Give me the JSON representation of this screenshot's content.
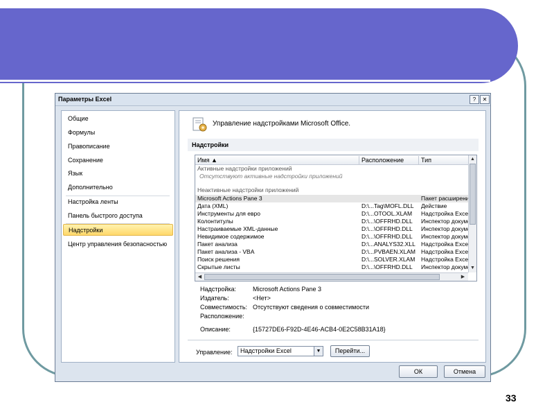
{
  "slide": {
    "number": "33"
  },
  "dialog": {
    "title": "Параметры Excel",
    "help_label": "?",
    "close_label": "✕",
    "nav": {
      "items": [
        {
          "label": "Общие"
        },
        {
          "label": "Формулы"
        },
        {
          "label": "Правописание"
        },
        {
          "label": "Сохранение"
        },
        {
          "label": "Язык"
        },
        {
          "label": "Дополнительно"
        },
        {
          "label": "Настройка ленты"
        },
        {
          "label": "Панель быстрого доступа"
        },
        {
          "label": "Надстройки",
          "selected": true
        },
        {
          "label": "Центр управления безопасностью"
        }
      ]
    },
    "header_text": "Управление надстройками Microsoft Office.",
    "section_title": "Надстройки",
    "grid": {
      "columns": [
        "Имя ▲",
        "Расположение",
        "Тип"
      ],
      "active_group": "Активные надстройки приложений",
      "active_note": "Отсутствуют активные надстройки приложений",
      "inactive_group": "Неактивные надстройки приложений",
      "rows": [
        {
          "name": "Microsoft Actions Pane 3",
          "location": "",
          "type": "Пакет расширения XML",
          "highlighted": true
        },
        {
          "name": "Дата (XML)",
          "location": "D:\\...Tag\\MOFL.DLL",
          "type": "Действие"
        },
        {
          "name": "Инструменты для евро",
          "location": "D:\\...OTOOL.XLAM",
          "type": "Надстройка Excel"
        },
        {
          "name": "Колонтитулы",
          "location": "D:\\...\\OFFRHD.DLL",
          "type": "Инспектор документов"
        },
        {
          "name": "Настраиваемые XML-данные",
          "location": "D:\\...\\OFFRHD.DLL",
          "type": "Инспектор документов"
        },
        {
          "name": "Невидимое содержимое",
          "location": "D:\\...\\OFFRHD.DLL",
          "type": "Инспектор документов"
        },
        {
          "name": "Пакет анализа",
          "location": "D:\\...ANALYS32.XLL",
          "type": "Надстройка Excel"
        },
        {
          "name": "Пакет анализа - VBA",
          "location": "D:\\...PVBAEN.XLAM",
          "type": "Надстройка Excel"
        },
        {
          "name": "Поиск решения",
          "location": "D:\\...SOLVER.XLAM",
          "type": "Надстройка Excel"
        },
        {
          "name": "Скрытые листы",
          "location": "D:\\...\\OFFRHD.DLL",
          "type": "Инспектор документов"
        }
      ]
    },
    "details": [
      {
        "label": "Надстройка:",
        "value": "Microsoft Actions Pane 3"
      },
      {
        "label": "Издатель:",
        "value": "<Нет>"
      },
      {
        "label": "Совместимость:",
        "value": "Отсутствуют сведения о совместимости"
      },
      {
        "label": "Расположение:",
        "value": ""
      },
      {
        "label": "Описание:",
        "value": "{15727DE6-F92D-4E46-ACB4-0E2C58B31A18}"
      }
    ],
    "manage": {
      "label": "Управление:",
      "selected": "Надстройки Excel",
      "go_label": "Перейти..."
    },
    "ok_label": "ОК",
    "cancel_label": "Отмена"
  },
  "icons": [
    "help-icon",
    "close-icon",
    "addins-gear-icon",
    "dropdown-arrow-icon",
    "scroll-arrow-icon"
  ]
}
